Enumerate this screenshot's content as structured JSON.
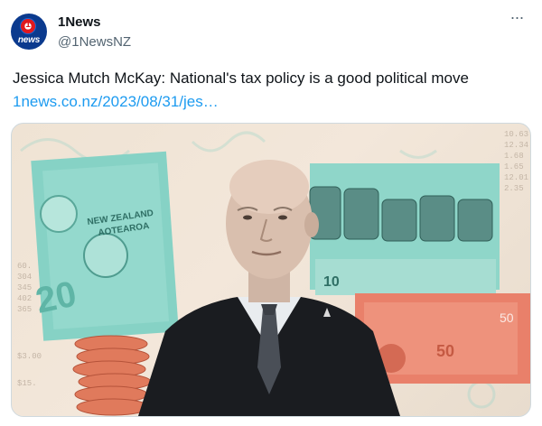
{
  "account": {
    "display_name": "1News",
    "handle": "@1NewsNZ",
    "avatar_mark": "1",
    "avatar_word": "news"
  },
  "tweet": {
    "text": "Jessica Mutch McKay: National's tax policy is a good political move",
    "link": "1news.co.nz/2023/08/31/jes…"
  },
  "media": {
    "banknote_texts": [
      "NEW ZEALAND",
      "AOTEAROA",
      "10",
      "50",
      "20"
    ],
    "figures": [
      "$550.00",
      "$350.00",
      "$200.00",
      "10.63",
      "12.34",
      "1.68",
      "$3.00"
    ]
  },
  "icons": {
    "more": "more-horizontal-icon"
  },
  "colors": {
    "link": "#1d9bf0",
    "muted": "#536471",
    "brand": "#0b3a8e",
    "teal": "#7fcfc3",
    "coral": "#e0705a"
  }
}
